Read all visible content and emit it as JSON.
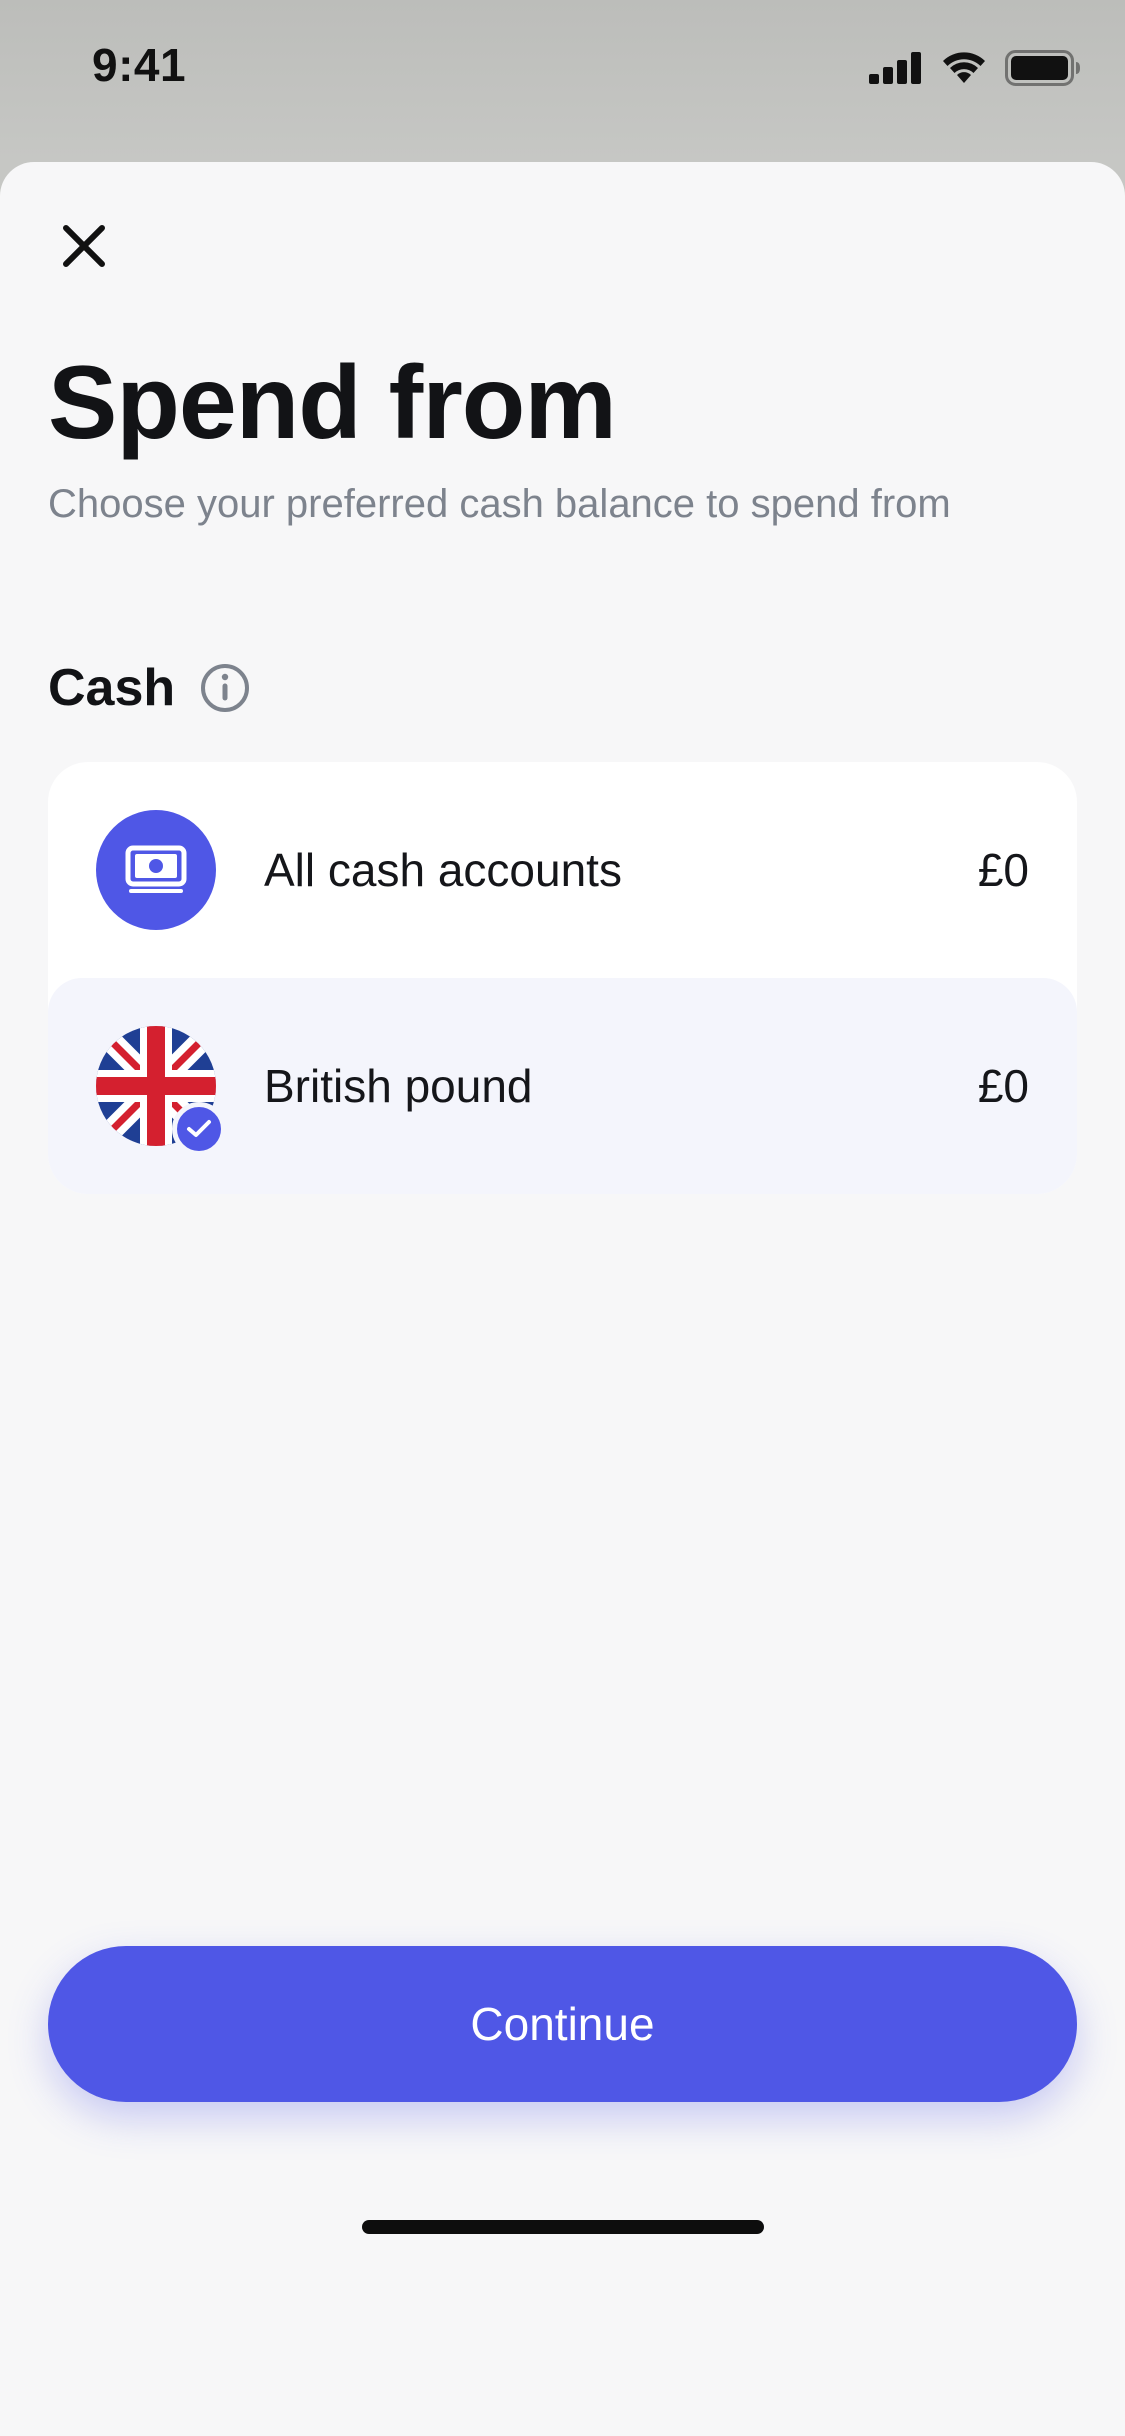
{
  "status_bar": {
    "time": "9:41",
    "icons": [
      "cellular-signal-icon",
      "wifi-icon",
      "battery-icon"
    ]
  },
  "sheet": {
    "close_icon": "close-icon",
    "title": "Spend from",
    "subtitle": "Choose your preferred cash balance to spend from"
  },
  "section": {
    "label": "Cash",
    "info_icon": "info-icon"
  },
  "accounts": [
    {
      "name": "All cash accounts",
      "balance": "£0",
      "icon": "cash-icon",
      "selected": false
    },
    {
      "name": "British pound",
      "balance": "£0",
      "icon": "uk-flag-icon",
      "selected": true
    }
  ],
  "continue_button": {
    "label": "Continue"
  },
  "colors": {
    "accent": "#4f57e6",
    "selected_row": "#f4f5fc",
    "sheet_background": "#f7f7f8",
    "text_primary": "#121316",
    "text_secondary": "#7d838d"
  }
}
